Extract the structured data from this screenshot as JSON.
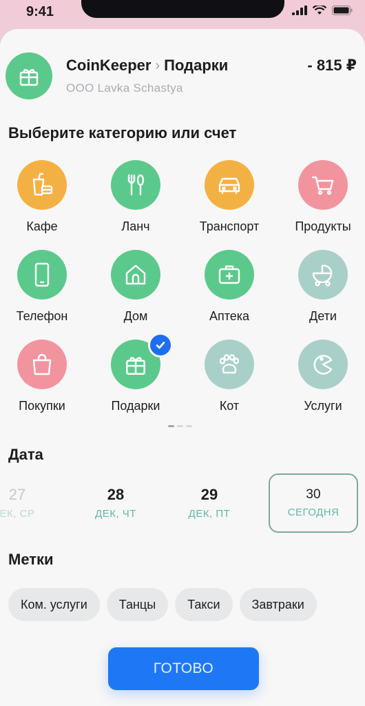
{
  "status": {
    "time": "9:41"
  },
  "header": {
    "merchant": "CoinKeeper",
    "category": "Подарки",
    "subtitle": "OOO Lavka Schastya",
    "amount": "- 815 ₽",
    "icon": "gift-icon"
  },
  "categories_title": "Выберите категорию или счет",
  "categories": [
    {
      "label": "Кафе",
      "color": "#f4b143",
      "icon": "cafe-icon",
      "selected": false
    },
    {
      "label": "Ланч",
      "color": "#5cc98c",
      "icon": "fork-knife-icon",
      "selected": false
    },
    {
      "label": "Транспорт",
      "color": "#f4b143",
      "icon": "car-icon",
      "selected": false
    },
    {
      "label": "Продукты",
      "color": "#f2949e",
      "icon": "cart-icon",
      "selected": false
    },
    {
      "label": "Телефон",
      "color": "#5cc98c",
      "icon": "phone-icon",
      "selected": false
    },
    {
      "label": "Дом",
      "color": "#5cc98c",
      "icon": "house-icon",
      "selected": false
    },
    {
      "label": "Аптека",
      "color": "#5cc98c",
      "icon": "medkit-icon",
      "selected": false
    },
    {
      "label": "Дети",
      "color": "#a9d0c8",
      "icon": "stroller-icon",
      "selected": false
    },
    {
      "label": "Покупки",
      "color": "#f2949e",
      "icon": "shopping-bag-icon",
      "selected": false
    },
    {
      "label": "Подарки",
      "color": "#5cc98c",
      "icon": "gift-icon",
      "selected": true
    },
    {
      "label": "Кот",
      "color": "#a9d0c8",
      "icon": "paw-icon",
      "selected": false
    },
    {
      "label": "Услуги",
      "color": "#a9d0c8",
      "icon": "pacman-icon",
      "selected": false
    }
  ],
  "date_title": "Дата",
  "dates": [
    {
      "num": "27",
      "sub": "ЕК, СР"
    },
    {
      "num": "28",
      "sub": "ДЕК, ЧТ"
    },
    {
      "num": "29",
      "sub": "ДЕК, ПТ"
    },
    {
      "num": "30",
      "sub": "СЕГОДНЯ"
    }
  ],
  "tags_title": "Метки",
  "tags": [
    "Ком. услуги",
    "Танцы",
    "Такси",
    "Завтраки"
  ],
  "done_label": "ГОТОВО"
}
